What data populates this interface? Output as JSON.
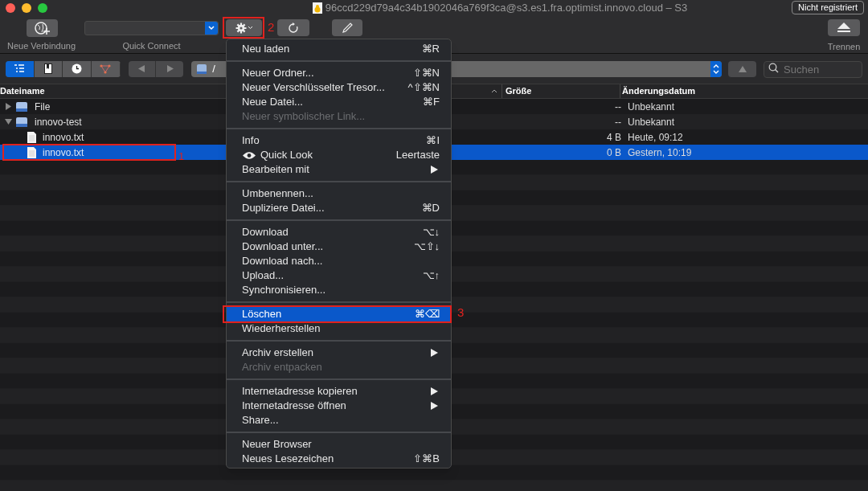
{
  "window": {
    "title": "96ccd229d79a4c34b1902046a769f3ca@s3.es1.fra.optimist.innovo.cloud – S3",
    "badge": "Nicht registriert"
  },
  "toolbar": {
    "new_connection": "Neue Verbindung",
    "quick_connect": "Quick Connect",
    "action_annotation": "2",
    "disconnect": "Trennen"
  },
  "navbar": {
    "views": [
      {
        "kind": "list",
        "selected": true
      },
      {
        "kind": "bookmarks",
        "selected": false
      },
      {
        "kind": "history",
        "selected": false
      },
      {
        "kind": "bonjour",
        "selected": false
      }
    ],
    "path": "/",
    "search": {
      "placeholder": "Suchen"
    }
  },
  "table": {
    "columns": [
      "Dateiname",
      "Größe",
      "Änderungsdatum"
    ],
    "rows": [
      {
        "name": "File",
        "kind": "folder",
        "expanded": false,
        "size": "--",
        "date": "Unbekannt",
        "selected": false,
        "children": []
      },
      {
        "name": "innovo-test",
        "kind": "folder",
        "expanded": true,
        "size": "--",
        "date": "Unbekannt",
        "selected": false,
        "children": [
          {
            "name": "innovo.txt",
            "kind": "file",
            "size": "4 B",
            "date": "Heute, 09:12",
            "selected": false
          },
          {
            "name": "innovo.txt",
            "kind": "file",
            "size": "0 B",
            "date": "Gestern, 10:19",
            "selected": true,
            "annotation": "1"
          }
        ]
      }
    ]
  },
  "menu": {
    "groups": [
      [
        {
          "label": "Neu laden",
          "shortcut": "⌘R",
          "disabled": false,
          "selected": false
        }
      ],
      [
        {
          "label": "Neuer Ordner...",
          "shortcut": "⇧⌘N",
          "disabled": false,
          "selected": false
        },
        {
          "label": "Neuer Verschlüsselter Tresor...",
          "shortcut": "^⇧⌘N",
          "disabled": false,
          "selected": false
        },
        {
          "label": "Neue Datei...",
          "shortcut": "⌘F",
          "disabled": false,
          "selected": false
        },
        {
          "label": "Neuer symbolischer Link...",
          "disabled": true,
          "selected": false
        }
      ],
      [
        {
          "label": "Info",
          "shortcut": "⌘I",
          "disabled": false,
          "selected": false
        },
        {
          "label": "Quick Look",
          "shortcut": "Leertaste",
          "kind": "eye",
          "disabled": false,
          "selected": false
        },
        {
          "label": "Bearbeiten mit",
          "kind": "submenu",
          "disabled": false,
          "selected": false
        }
      ],
      [
        {
          "label": "Umbenennen...",
          "disabled": false,
          "selected": false
        },
        {
          "label": "Dupliziere Datei...",
          "shortcut": "⌘D",
          "disabled": false,
          "selected": false
        }
      ],
      [
        {
          "label": "Download",
          "shortcut": "⌥↓",
          "disabled": false,
          "selected": false
        },
        {
          "label": "Download unter...",
          "shortcut": "⌥⇧↓",
          "disabled": false,
          "selected": false
        },
        {
          "label": "Download nach...",
          "disabled": false,
          "selected": false
        },
        {
          "label": "Upload...",
          "shortcut": "⌥↑",
          "disabled": false,
          "selected": false
        },
        {
          "label": "Synchronisieren...",
          "disabled": false,
          "selected": false
        }
      ],
      [
        {
          "label": "Löschen",
          "shortcut": "⌘⌫",
          "disabled": false,
          "selected": true,
          "annotation": "3"
        },
        {
          "label": "Wiederherstellen",
          "disabled": false,
          "selected": false
        }
      ],
      [
        {
          "label": "Archiv erstellen",
          "kind": "submenu",
          "disabled": false,
          "selected": false
        },
        {
          "label": "Archiv entpacken",
          "disabled": true,
          "selected": false
        }
      ],
      [
        {
          "label": "Internetadresse kopieren",
          "kind": "submenu",
          "disabled": false,
          "selected": false
        },
        {
          "label": "Internetadresse öffnen",
          "kind": "submenu",
          "disabled": false,
          "selected": false
        },
        {
          "label": "Share...",
          "disabled": false,
          "selected": false
        }
      ],
      [
        {
          "label": "Neuer Browser",
          "disabled": false,
          "selected": false
        },
        {
          "label": "Neues Lesezeichen",
          "shortcut": "⇧⌘B",
          "disabled": false,
          "selected": false
        }
      ]
    ]
  }
}
